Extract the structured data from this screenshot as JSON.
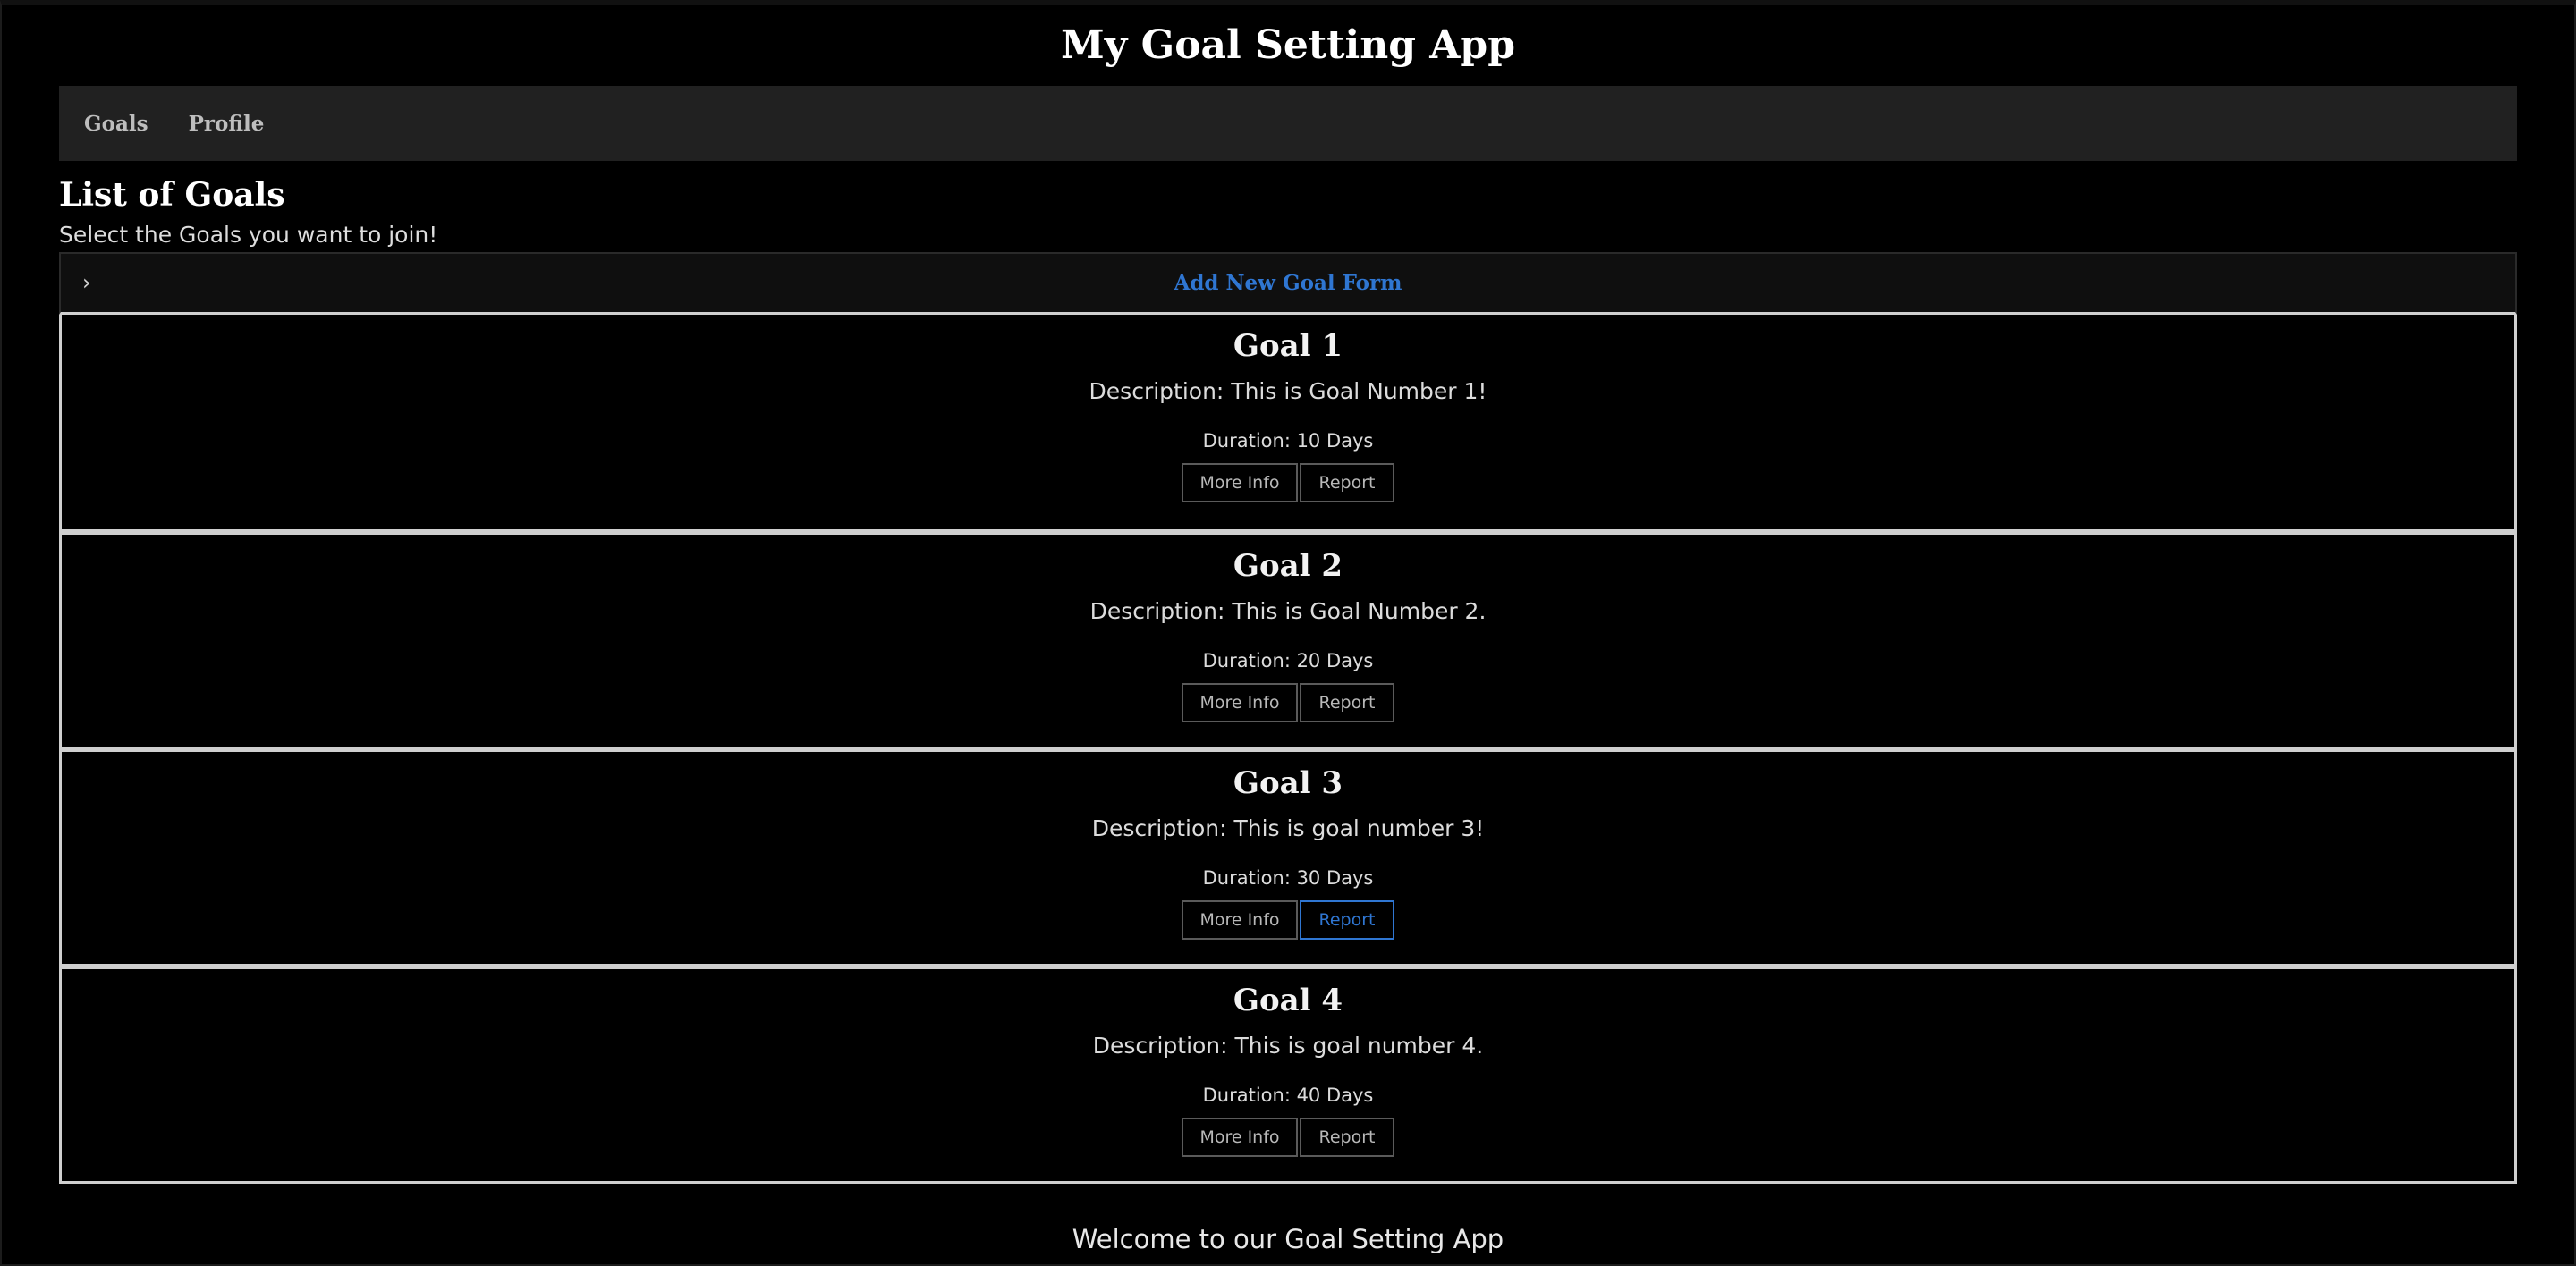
{
  "app": {
    "title": "My Goal Setting App",
    "accent_color": "#2f76d2",
    "background_color": "#000000"
  },
  "nav": {
    "items": [
      {
        "label": "Goals"
      },
      {
        "label": "Profile"
      }
    ]
  },
  "section": {
    "title": "List of Goals",
    "subtitle": "Select the Goals you want to join!"
  },
  "add_form": {
    "chevron_icon": "chevron-right-icon",
    "label": "Add New Goal Form",
    "expanded": false
  },
  "goals": [
    {
      "title": "Goal 1",
      "description": "Description: This is Goal Number 1!",
      "duration": "Duration: 10 Days",
      "more_info_label": "More Info",
      "report_label": "Report"
    },
    {
      "title": "Goal 2",
      "description": "Description: This is Goal Number 2.",
      "duration": "Duration: 20 Days",
      "more_info_label": "More Info",
      "report_label": "Report"
    },
    {
      "title": "Goal 3",
      "description": "Description: This is goal number 3!",
      "duration": "Duration: 30 Days",
      "more_info_label": "More Info",
      "report_label": "Report",
      "report_active": true
    },
    {
      "title": "Goal 4",
      "description": "Description: This is goal number 4.",
      "duration": "Duration: 40 Days",
      "more_info_label": "More Info",
      "report_label": "Report"
    }
  ],
  "footer": {
    "text": "Welcome to our Goal Setting App"
  }
}
